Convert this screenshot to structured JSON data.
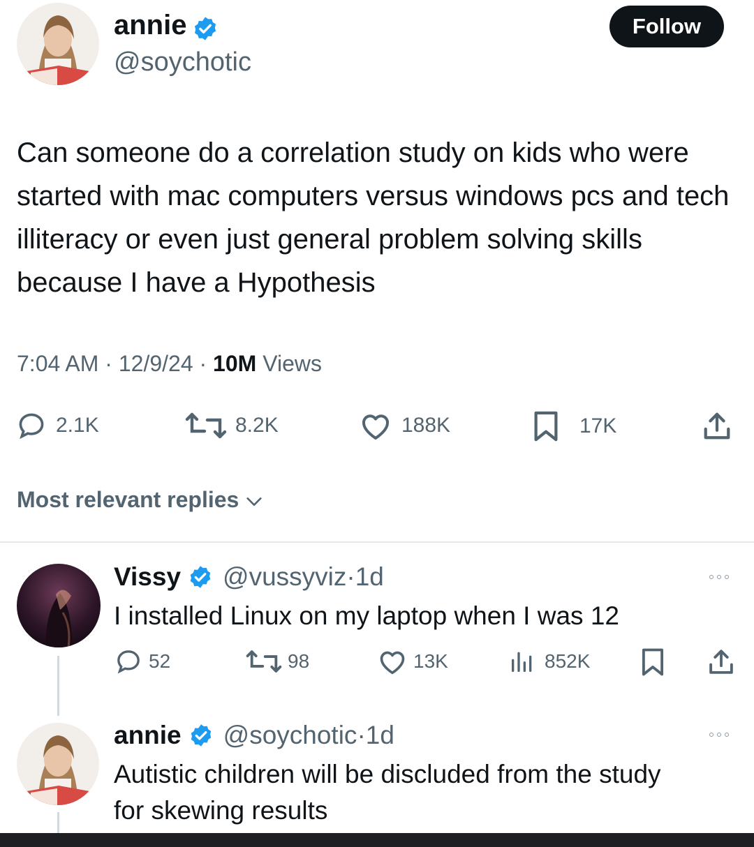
{
  "tweet": {
    "author": {
      "name": "annie",
      "handle": "@soychotic",
      "verified": true
    },
    "follow_label": "Follow",
    "text": "Can someone do a correlation study on kids who were started with mac computers versus windows pcs and tech illiteracy or even just general problem solving skills because I have a Hypothesis",
    "time": "7:04 AM",
    "date": "12/9/24",
    "views_count": "10M",
    "views_label": "Views",
    "stats": {
      "replies": "2.1K",
      "reposts": "8.2K",
      "likes": "188K",
      "bookmarks": "17K"
    }
  },
  "replies_sort": {
    "label": "Most relevant replies"
  },
  "replies": [
    {
      "name": "Vissy",
      "handle": "@vussyviz",
      "age": "1d",
      "verified": true,
      "text": "I installed Linux on my laptop when I was 12",
      "stats": {
        "replies": "52",
        "reposts": "98",
        "likes": "13K",
        "views": "852K"
      }
    },
    {
      "name": "annie",
      "handle": "@soychotic",
      "age": "1d",
      "verified": true,
      "text_line1": "Autistic children will be discluded from the study",
      "text_line2": "for skewing results"
    }
  ],
  "icons": {
    "verified": "verified-badge-icon",
    "reply": "reply-icon",
    "repost": "repost-icon",
    "like": "heart-icon",
    "bookmark": "bookmark-icon",
    "share": "share-icon",
    "views": "views-chart-icon",
    "more": "more-icon",
    "chevron": "chevron-down-icon"
  },
  "colors": {
    "verified": "#1d9bf0",
    "text": "#0f1419",
    "secondary": "#536471",
    "button": "#0f1419"
  }
}
